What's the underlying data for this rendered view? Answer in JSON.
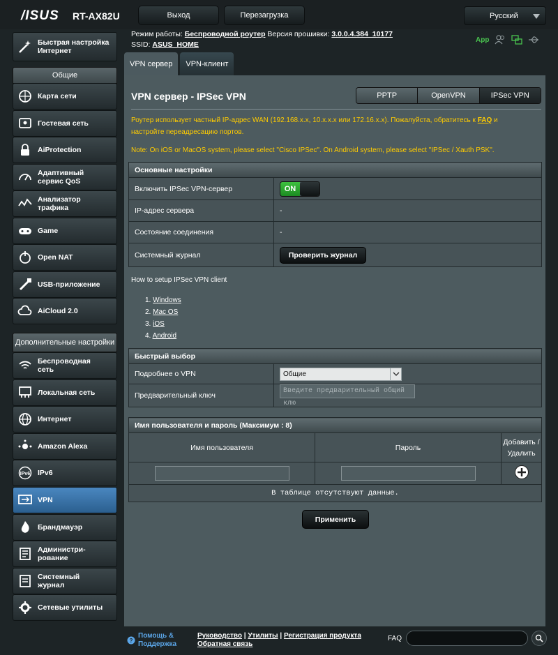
{
  "header": {
    "brand": "/ISUS",
    "model": "RT-AX82U",
    "logout": "Выход",
    "reboot": "Перезагрузка",
    "language": "Русский"
  },
  "info": {
    "mode_label": "Режим работы:",
    "mode_value": "Беспроводной роутер",
    "fw_label": "Версия прошивки:",
    "fw_value": "3.0.0.4.384_10177",
    "ssid_label": "SSID:",
    "ssid_value": "ASUS_HOME",
    "app_label": "App"
  },
  "sidebar": {
    "quick": "Быстрая настройка Интернет",
    "general_header": "Общие",
    "general": [
      {
        "label": "Карта сети",
        "icon": "globe-network-icon"
      },
      {
        "label": "Гостевая сеть",
        "icon": "guest-network-icon"
      },
      {
        "label": "AiProtection",
        "icon": "lock-icon"
      },
      {
        "label": "Адаптивный сервис QoS",
        "icon": "gauge-icon"
      },
      {
        "label": "Анализатор трафика",
        "icon": "traffic-icon"
      },
      {
        "label": "Game",
        "icon": "gamepad-icon"
      },
      {
        "label": "Open NAT",
        "icon": "open-nat-icon"
      },
      {
        "label": "USB-приложение",
        "icon": "usb-icon"
      },
      {
        "label": "AiCloud 2.0",
        "icon": "cloud-icon"
      }
    ],
    "advanced_header": "Дополнительные настройки",
    "advanced": [
      {
        "label": "Беспроводная сеть",
        "icon": "wifi-icon"
      },
      {
        "label": "Локальная сеть",
        "icon": "lan-icon"
      },
      {
        "label": "Интернет",
        "icon": "globe-icon"
      },
      {
        "label": "Amazon Alexa",
        "icon": "alexa-icon"
      },
      {
        "label": "IPv6",
        "icon": "ipv6-icon"
      },
      {
        "label": "VPN",
        "icon": "vpn-icon"
      },
      {
        "label": "Брандмауэр",
        "icon": "firewall-icon"
      },
      {
        "label": "Администри-рование",
        "icon": "admin-icon"
      },
      {
        "label": "Системный журнал",
        "icon": "log-icon"
      },
      {
        "label": "Сетевые утилиты",
        "icon": "tools-icon"
      }
    ]
  },
  "tabs": [
    "VPN сервер",
    "VPN-клиент"
  ],
  "main": {
    "title": "VPN сервер - IPSec VPN",
    "segments": [
      "PPTP",
      "OpenVPN",
      "IPSec VPN"
    ],
    "notice1": "Роутер использует частный IP-адрес WAN (192.168.x.x, 10.x.x.x или 172.16.x.x). Пожалуйста, обратитесь к",
    "notice1_link": "FAQ",
    "notice1_end": "и",
    "notice1_line2": "настройте переадресацию портов.",
    "notice2": "Note: On iOS or MacOS system, please select \"Cisco IPSec\". On Android system, please select \"IPSec / Xauth PSK\".",
    "basic": {
      "header": "Основные настройки",
      "enable_label": "Включить IPSec VPN-сервер",
      "toggle": "ON",
      "server_ip_label": "IP-адрес сервера",
      "server_ip_value": "-",
      "conn_state_label": "Состояние соединения",
      "conn_state_value": "-",
      "syslog_label": "Системный журнал",
      "syslog_button": "Проверить журнал"
    },
    "howto": "How to setup IPSec VPN client",
    "os_list": [
      "Windows",
      "Mac OS",
      "iOS",
      "Android"
    ],
    "quick": {
      "header": "Быстрый выбор",
      "vpn_details_label": "Подробнее о VPN",
      "vpn_details_value": "Общие",
      "psk_label": "Предварительный ключ",
      "psk_placeholder": "Введите предварительный общий клю"
    },
    "users": {
      "header": "Имя пользователя и пароль (Максимум : 8)",
      "col_user": "Имя пользователя",
      "col_pass": "Пароль",
      "col_action": "Добавить / Удалить",
      "empty": "В таблице отсутствуют данные."
    },
    "apply": "Применить"
  },
  "footer": {
    "help": "Помощь & Поддержка",
    "manual": "Руководство",
    "utilities": "Утилиты",
    "registration": "Регистрация продукта",
    "feedback": "Обратная связь",
    "faq": "FAQ"
  }
}
